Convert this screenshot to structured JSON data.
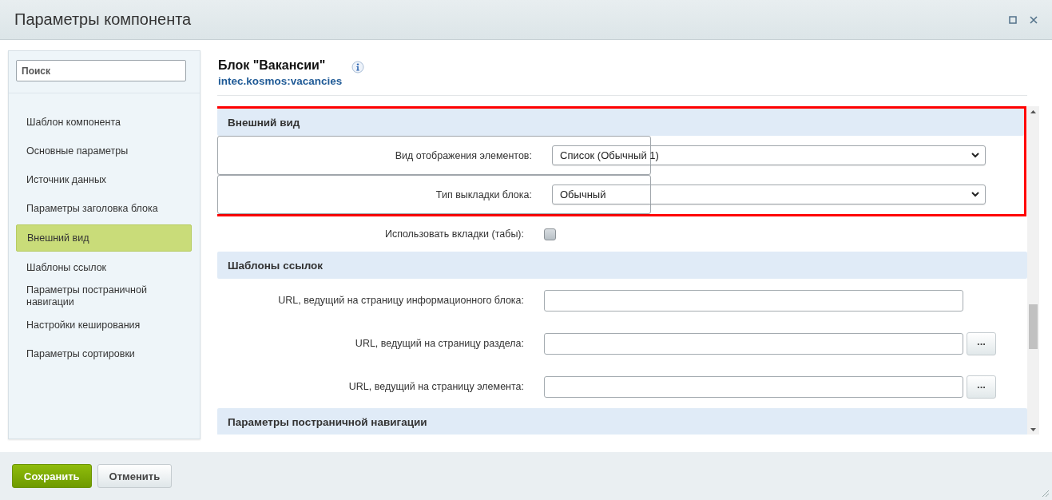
{
  "window": {
    "title": "Параметры компонента"
  },
  "sidebar": {
    "search": {
      "placeholder": "Поиск"
    },
    "items": [
      {
        "label": "Шаблон компонента",
        "selected": false
      },
      {
        "label": "Основные параметры",
        "selected": false
      },
      {
        "label": "Источник данных",
        "selected": false
      },
      {
        "label": "Параметры заголовка блока",
        "selected": false
      },
      {
        "label": "Внешний вид",
        "selected": true
      },
      {
        "label": "Шаблоны ссылок",
        "selected": false
      },
      {
        "label": "Параметры постраничной навигации",
        "selected": false
      },
      {
        "label": "Настройки кеширования",
        "selected": false
      },
      {
        "label": "Параметры сортировки",
        "selected": false
      }
    ]
  },
  "component": {
    "title": "Блок \"Вакансии\"",
    "code": "intec.kosmos:vacancies"
  },
  "sections": [
    {
      "title": "Внешний вид",
      "highlighted": true,
      "rows": [
        {
          "kind": "select",
          "label": "Вид отображения элементов:",
          "value": "Список (Обычный 1)"
        },
        {
          "kind": "select",
          "label": "Тип выкладки блока:",
          "value": "Обычный"
        }
      ]
    },
    {
      "highlighted": false,
      "rows": [
        {
          "kind": "checkbox",
          "label": "Использовать вкладки (табы):",
          "checked": false
        }
      ]
    },
    {
      "title": "Шаблоны ссылок",
      "highlighted": false,
      "rows": [
        {
          "kind": "text",
          "label": "URL, ведущий на страницу информационного блока:"
        },
        {
          "kind": "text_button",
          "label": "URL, ведущий на страницу раздела:",
          "button": "..."
        },
        {
          "kind": "text_button",
          "label": "URL, ведущий на страницу элемента:",
          "button": "..."
        }
      ]
    },
    {
      "title": "Параметры постраничной навигации",
      "highlighted": false
    }
  ],
  "buttons": [
    {
      "label": "Сохранить",
      "kind": "primary"
    },
    {
      "label": "Отменить",
      "kind": "secondary"
    }
  ]
}
